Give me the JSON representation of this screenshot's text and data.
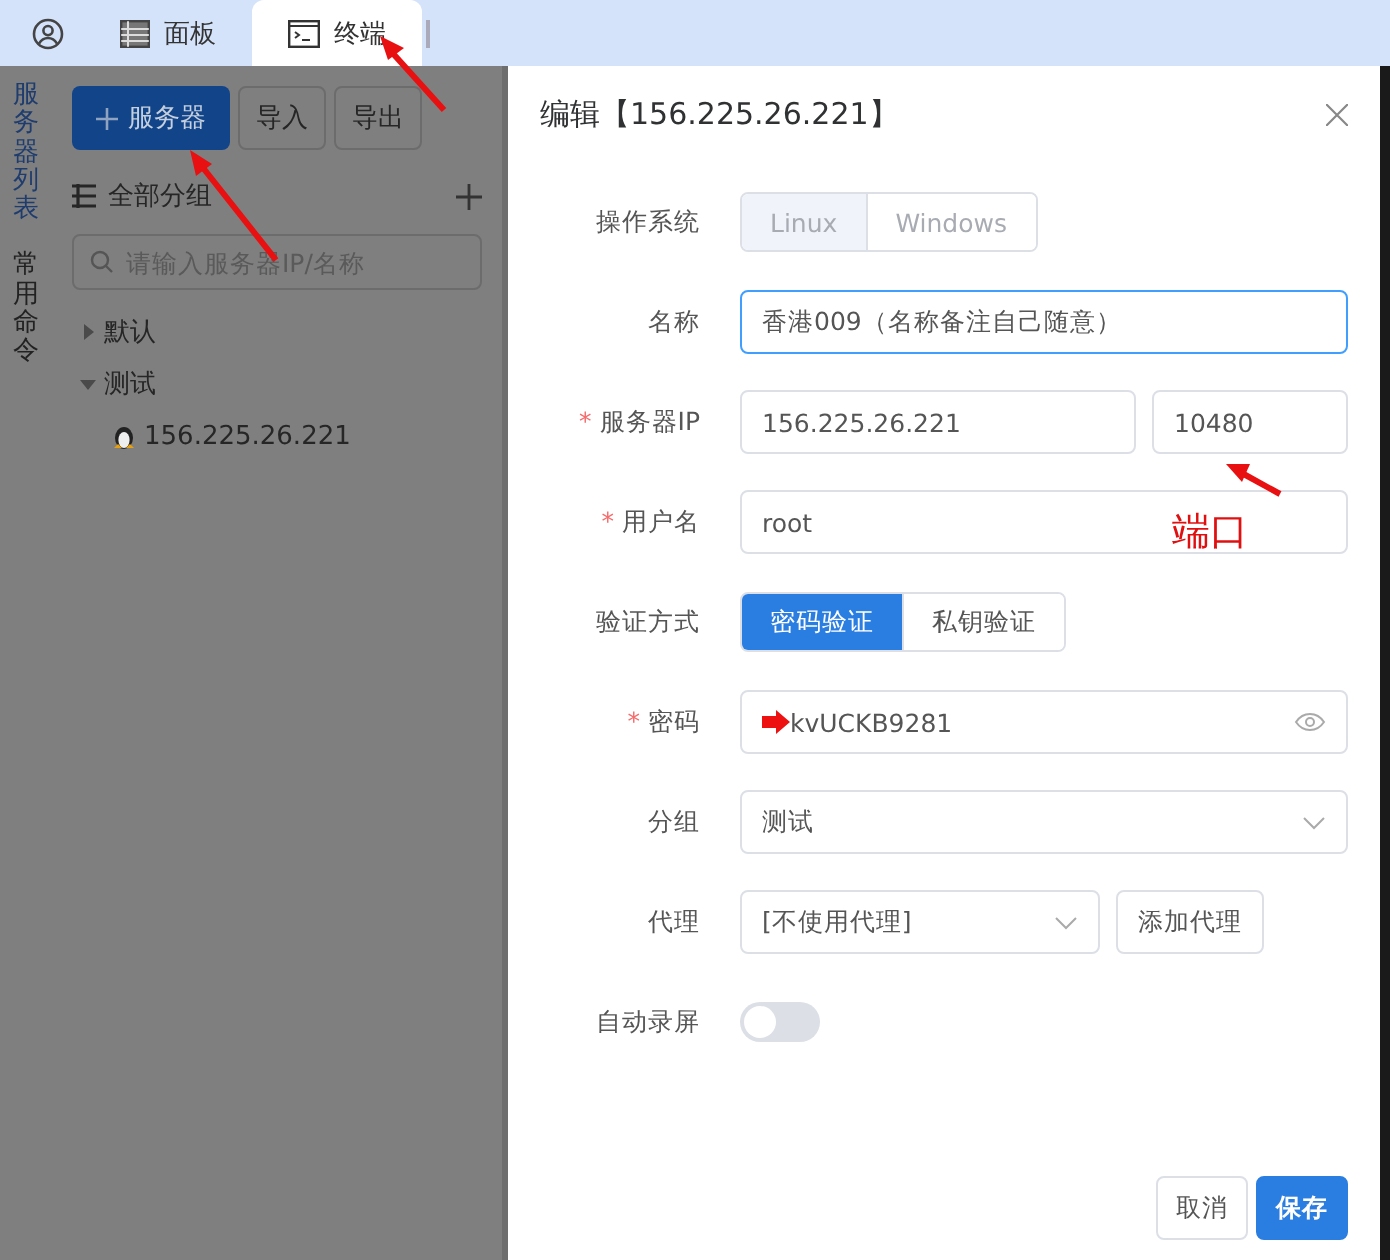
{
  "top_tabs": [
    {
      "kind": "avatar",
      "selected": false
    },
    {
      "kind": "panel",
      "label": "面板",
      "selected": false
    },
    {
      "kind": "terminal",
      "label": "终端",
      "selected": true
    }
  ],
  "side_tabs": [
    {
      "label": "服务器列表",
      "selected": true
    },
    {
      "label": "常用命令",
      "selected": false
    }
  ],
  "server_panel": {
    "buttons": [
      {
        "label": "服务器",
        "kind": "primary"
      },
      {
        "label": "导入",
        "kind": "default"
      },
      {
        "label": "导出",
        "kind": "default"
      }
    ],
    "group_header": "全部分组",
    "search": {
      "placeholder": "请输入服务器IP/名称"
    },
    "tree": [
      {
        "kind": "group",
        "label": "默认",
        "expanded": false
      },
      {
        "kind": "group",
        "label": "测试",
        "expanded": true,
        "children": [
          {
            "kind": "server",
            "label": "156.225.26.221"
          }
        ]
      }
    ]
  },
  "dialog": {
    "title": "编辑【156.225.26.221】",
    "fields": [
      {
        "kind": "segmented",
        "label": "操作系统",
        "options": [
          {
            "label": "Linux",
            "selected": true
          },
          {
            "label": "Windows",
            "selected": false
          }
        ],
        "disabled": true
      },
      {
        "kind": "text",
        "label": "名称",
        "value": "香港009（名称备注自己随意）",
        "focused": true
      },
      {
        "kind": "host",
        "label": "服务器IP",
        "required_mark": "*",
        "value": "156.225.26.221",
        "port": "10480"
      },
      {
        "kind": "text",
        "label": "用户名",
        "required_mark": "*",
        "value": "root",
        "focused": false
      },
      {
        "kind": "segmented",
        "label": "验证方式",
        "options": [
          {
            "label": "密码验证",
            "selected": true
          },
          {
            "label": "私钥验证",
            "selected": false
          }
        ],
        "disabled": false
      },
      {
        "kind": "password",
        "label": "密码",
        "required_mark": "*",
        "value": "kvUCKB9281"
      },
      {
        "kind": "select",
        "label": "分组",
        "value": "测试"
      },
      {
        "kind": "select_button",
        "label": "代理",
        "value": "[不使用代理]",
        "button": "添加代理"
      },
      {
        "kind": "switch",
        "label": "自动录屏",
        "on": false
      }
    ],
    "buttons": [
      {
        "label": "取消",
        "kind": "default"
      },
      {
        "label": "保存",
        "kind": "primary"
      }
    ]
  },
  "annotation": {
    "text": "端口"
  }
}
